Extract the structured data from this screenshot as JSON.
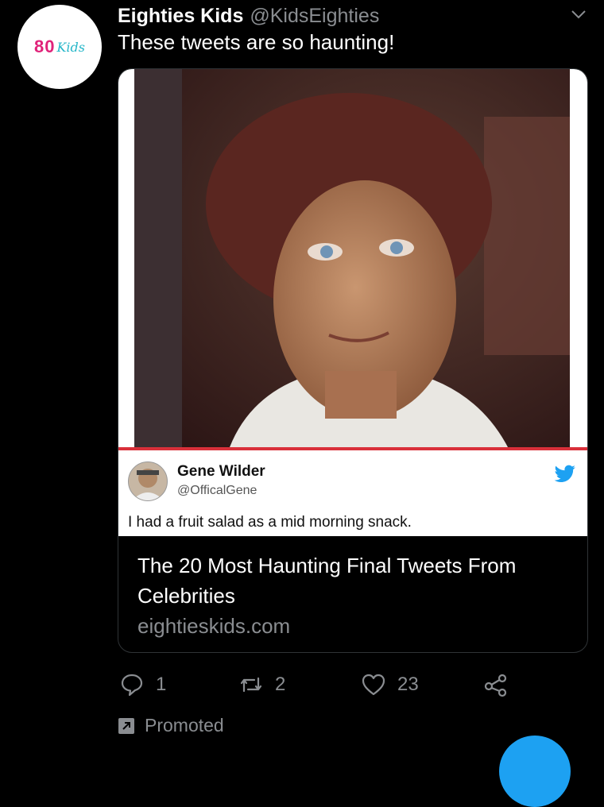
{
  "tweet": {
    "author_name": "Eighties Kids",
    "author_handle": "@KidsEighties",
    "text": "These tweets are so haunting!",
    "avatar_logo": {
      "number": "80",
      "script": "Kids"
    }
  },
  "card": {
    "embedded_tweet": {
      "name": "Gene Wilder",
      "handle": "@OfficalGene",
      "text": "I had a fruit salad as a mid morning snack."
    },
    "title": "The 20 Most Haunting Final Tweets From Celebrities",
    "domain": "eightieskids.com"
  },
  "actions": {
    "reply_count": "1",
    "retweet_count": "2",
    "like_count": "23"
  },
  "promoted_label": "Promoted",
  "icons": {
    "menu": "chevron-down-icon",
    "reply": "reply-icon",
    "retweet": "retweet-icon",
    "like": "heart-icon",
    "share": "share-icon",
    "promoted": "promoted-icon",
    "bird": "twitter-bird-icon"
  },
  "colors": {
    "background": "#000000",
    "muted_text": "#8a8d91",
    "accent": "#1da1f2",
    "logo_pink": "#e0237a",
    "logo_teal": "#27b7c9",
    "embed_divider": "#d9303a"
  }
}
